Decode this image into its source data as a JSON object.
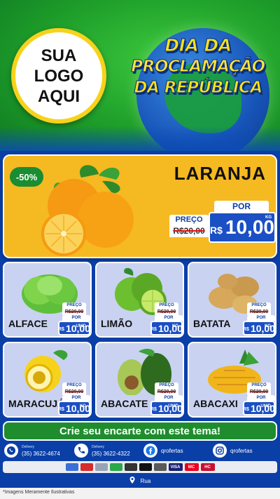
{
  "header": {
    "logo_lines": [
      "SUA",
      "LOGO",
      "AQUI"
    ],
    "title_lines": [
      "DIA DA",
      "PROCLAMAÇÃO",
      "DA REPÚBLICA"
    ]
  },
  "hero": {
    "name": "LARANJA",
    "discount": "-50%",
    "preco_label": "PREÇO",
    "old_price": "R$20,00",
    "por_label": "POR",
    "currency": "R$",
    "new_price": "10,00",
    "unit": "KG"
  },
  "products": [
    {
      "name": "ALFACE",
      "preco_label": "PREÇO",
      "old_price": "R$20,00",
      "por_label": "POR",
      "currency": "R$",
      "new_price": "10,00",
      "unit": "UNID"
    },
    {
      "name": "LIMÃO",
      "preco_label": "PREÇO",
      "old_price": "R$20,00",
      "por_label": "POR",
      "currency": "R$",
      "new_price": "10,00",
      "unit": "KG"
    },
    {
      "name": "BATATA",
      "preco_label": "PREÇO",
      "old_price": "R$20,00",
      "por_label": "POR",
      "currency": "R$",
      "new_price": "10,00",
      "unit": "KG"
    },
    {
      "name": "MARACUJÁ",
      "preco_label": "PREÇO",
      "old_price": "R$20,00",
      "por_label": "POR",
      "currency": "R$",
      "new_price": "10,00",
      "unit": "KG"
    },
    {
      "name": "ABACATE",
      "preco_label": "PREÇO",
      "old_price": "R$20,00",
      "por_label": "POR",
      "currency": "R$",
      "new_price": "10,00",
      "unit": "UNID"
    },
    {
      "name": "ABACAXI",
      "preco_label": "PREÇO",
      "old_price": "R$20,00",
      "por_label": "POR",
      "currency": "R$",
      "new_price": "10,00",
      "unit": "UNID"
    }
  ],
  "cta": "Crie seu encarte com este tema!",
  "contacts": {
    "whatsapp": {
      "label": "Delivery",
      "value": "(35) 3622-4674",
      "icon": "whatsapp-icon"
    },
    "phone": {
      "label": "Delivery",
      "value": "(35) 3622-4322",
      "icon": "phone-icon"
    },
    "facebook": {
      "value": "qrofertas",
      "icon": "facebook-icon"
    },
    "instagram": {
      "value": "qrofertas",
      "icon": "instagram-icon"
    }
  },
  "payments": [
    "VISA",
    "MC",
    "HC"
  ],
  "address": "Rua",
  "footer": "*Imagens Meramente Ilustrativas",
  "colors": {
    "green": "#1f8d2e",
    "blue": "#0b3ea6",
    "yellow": "#f5b921",
    "price_blue": "#1b4fc4"
  }
}
